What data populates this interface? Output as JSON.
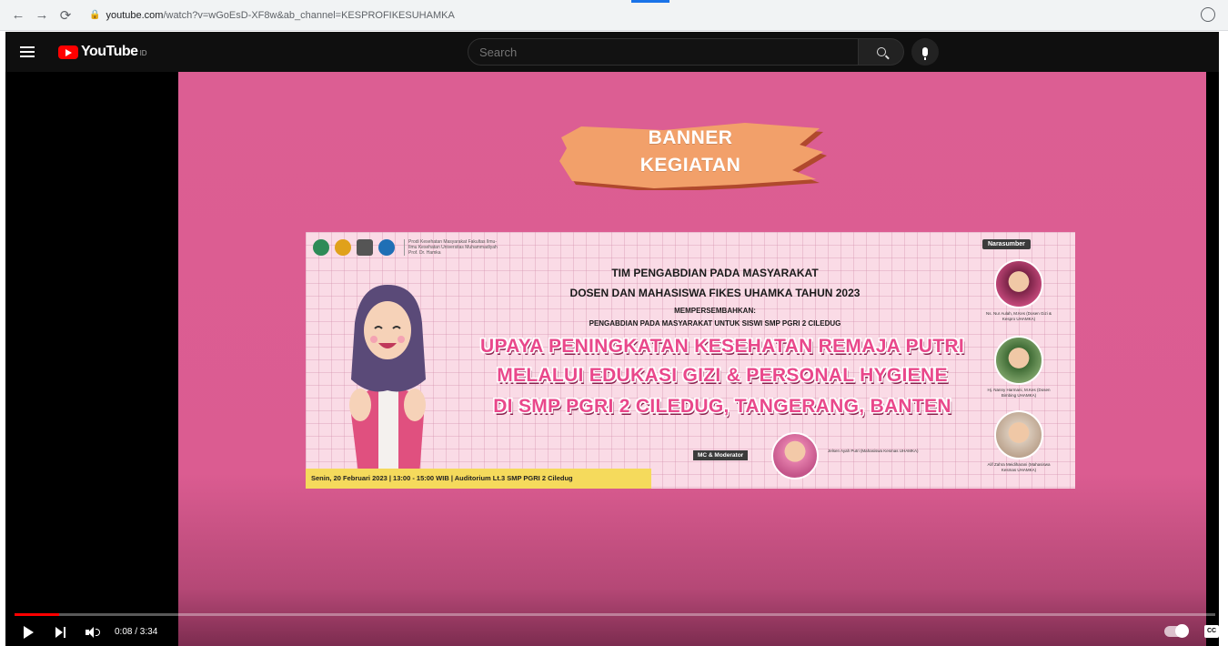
{
  "browser": {
    "url_host": "youtube.com",
    "url_path": "/watch?v=wGoEsD-XF8w&ab_channel=KESPROFIKESUHAMKA"
  },
  "youtube": {
    "logo_text": "YouTube",
    "logo_sup": "ID",
    "search_placeholder": "Search"
  },
  "video": {
    "banner_title_line1": "BANNER",
    "banner_title_line2": "KEGIATAN",
    "poster": {
      "logo_caption": "Prodi Kesehatan Masyarakat Fakultas Ilmu-Ilmu Kesehatan Universitas Muhammadiyah Prof. Dr. Hamka",
      "line1": "TIM PENGABDIAN PADA MASYARAKAT",
      "line2": "DOSEN DAN MAHASISWA FIKES UHAMKA TAHUN 2023",
      "line3": "MEMPERSEMBAHKAN:",
      "line4": "PENGABDIAN PADA MASYARAKAT UNTUK SISWI SMP PGRI 2 CILEDUG",
      "headline1": "UPAYA PENINGKATAN KESEHATAN REMAJA PUTRI",
      "headline2": "MELALUI EDUKASI GIZI & PERSONAL HYGIENE",
      "headline3": "DI SMP PGRI 2 CILEDUG, TANGERANG, BANTEN",
      "speakers_label": "Narasumber",
      "speakers": [
        {
          "caption": "Ns. Nur Aulah, M.Kes (Dosen Gizi & Kespro UHAMKA)"
        },
        {
          "caption": "Hj. Nanny Harmani, M.Kes (Dosen Bimbing UHAMKA)"
        },
        {
          "caption": "Alif Zahra Meidiharani (Mahasiswa Kesmas UHAMKA)"
        }
      ],
      "mc_label": "MC & Moderator",
      "mc_caption": "Jelsen Ayah Putri (Mahasiswa Kesmas UHAMKA)",
      "date_text": "Senin, 20 Februari 2023 | 13:00 - 15:00 WIB | Auditorium Lt.3 SMP PGRI 2 Ciledug"
    }
  },
  "player": {
    "time_display": "0:08 / 3:34",
    "progress_fraction": 0.037,
    "cc_label": "CC"
  },
  "colors": {
    "video_bg": "#dc5e93",
    "headline": "#e9488b",
    "progress": "#ff0000",
    "date_strip": "#f5da5c"
  }
}
